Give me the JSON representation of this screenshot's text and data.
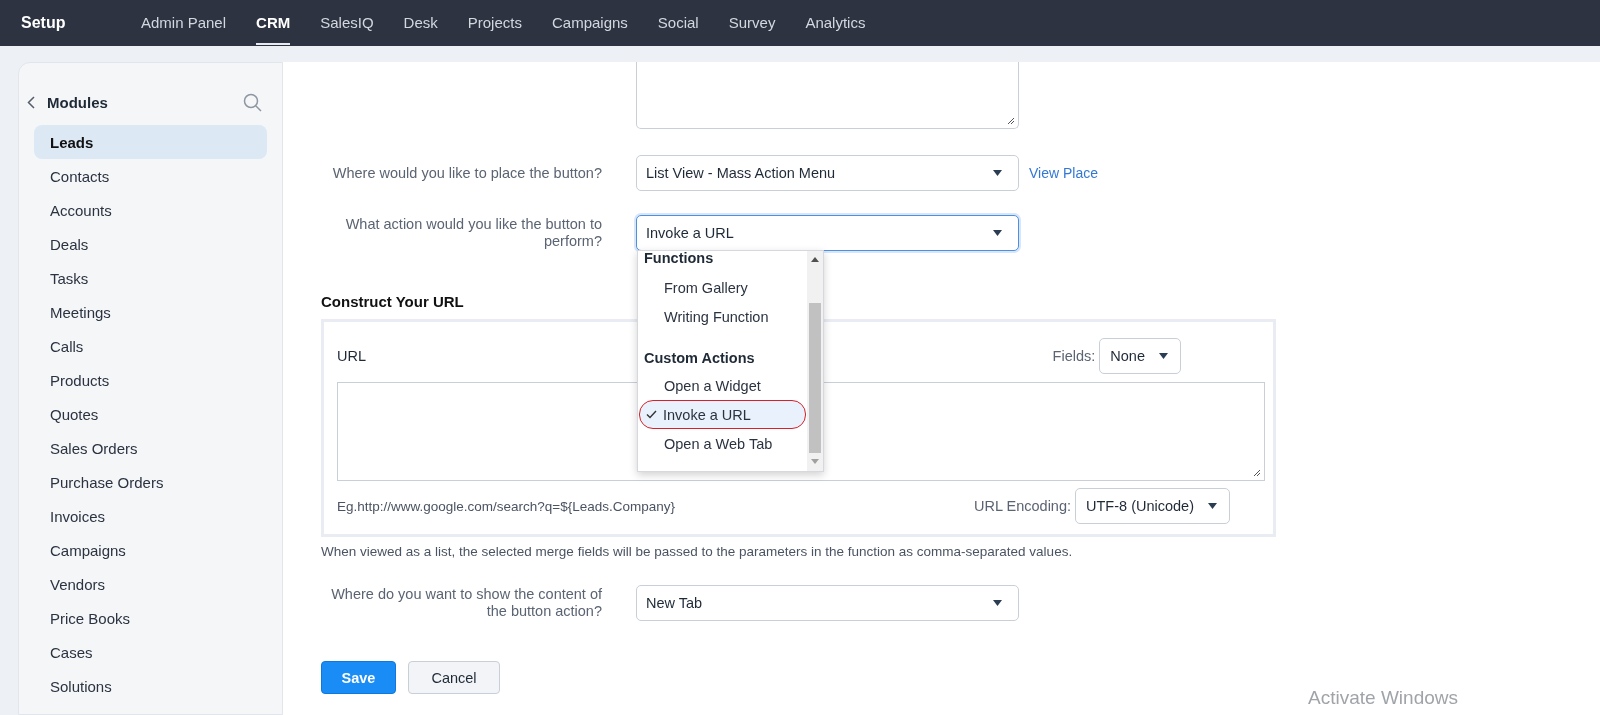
{
  "top_nav": {
    "title": "Setup",
    "tabs": [
      {
        "label": "Admin Panel",
        "selected": false
      },
      {
        "label": "CRM",
        "selected": true
      },
      {
        "label": "SalesIQ",
        "selected": false
      },
      {
        "label": "Desk",
        "selected": false
      },
      {
        "label": "Projects",
        "selected": false
      },
      {
        "label": "Campaigns",
        "selected": false
      },
      {
        "label": "Social",
        "selected": false
      },
      {
        "label": "Survey",
        "selected": false
      },
      {
        "label": "Analytics",
        "selected": false
      }
    ]
  },
  "sidebar": {
    "title": "Modules",
    "items": [
      {
        "label": "Leads",
        "selected": true
      },
      {
        "label": "Contacts",
        "selected": false
      },
      {
        "label": "Accounts",
        "selected": false
      },
      {
        "label": "Deals",
        "selected": false
      },
      {
        "label": "Tasks",
        "selected": false
      },
      {
        "label": "Meetings",
        "selected": false
      },
      {
        "label": "Calls",
        "selected": false
      },
      {
        "label": "Products",
        "selected": false
      },
      {
        "label": "Quotes",
        "selected": false
      },
      {
        "label": "Sales Orders",
        "selected": false
      },
      {
        "label": "Purchase Orders",
        "selected": false
      },
      {
        "label": "Invoices",
        "selected": false
      },
      {
        "label": "Campaigns",
        "selected": false
      },
      {
        "label": "Vendors",
        "selected": false
      },
      {
        "label": "Price Books",
        "selected": false
      },
      {
        "label": "Cases",
        "selected": false
      },
      {
        "label": "Solutions",
        "selected": false
      }
    ]
  },
  "form": {
    "fields": [
      {
        "label": "Where would you like to place the button?",
        "value": "List View - Mass Action Menu",
        "link": "View Place",
        "focused": false
      },
      {
        "label": "What action would you like the button to perform?",
        "value": "Invoke a URL",
        "focused": true
      }
    ],
    "action_menu": {
      "groups": [
        {
          "title": "Functions",
          "items": [
            {
              "label": "From Gallery",
              "selected": false
            },
            {
              "label": "Writing Function",
              "selected": false
            }
          ]
        },
        {
          "title": "Custom Actions",
          "items": [
            {
              "label": "Open a Widget",
              "selected": false
            },
            {
              "label": "Invoke a URL",
              "selected": true
            },
            {
              "label": "Open a Web Tab",
              "selected": false
            }
          ]
        }
      ]
    },
    "url_section": {
      "heading": "Construct Your URL",
      "url_label": "URL",
      "fields_label": "Fields:",
      "fields_value": "None",
      "example": "Eg.http://www.google.com/search?q=${Leads.Company}",
      "encoding_label": "URL Encoding:",
      "encoding_value": "UTF-8 (Unicode)"
    },
    "note": "When viewed as a list, the selected merge fields will be passed to the parameters in the function as comma-separated values.",
    "display_field": {
      "label": "Where do you want to show the content of the button action?",
      "value": "New Tab"
    },
    "buttons": [
      {
        "label": "Save",
        "kind": "primary"
      },
      {
        "label": "Cancel",
        "kind": "secondary"
      }
    ]
  },
  "os_overlay": {
    "text": "Activate Windows"
  }
}
